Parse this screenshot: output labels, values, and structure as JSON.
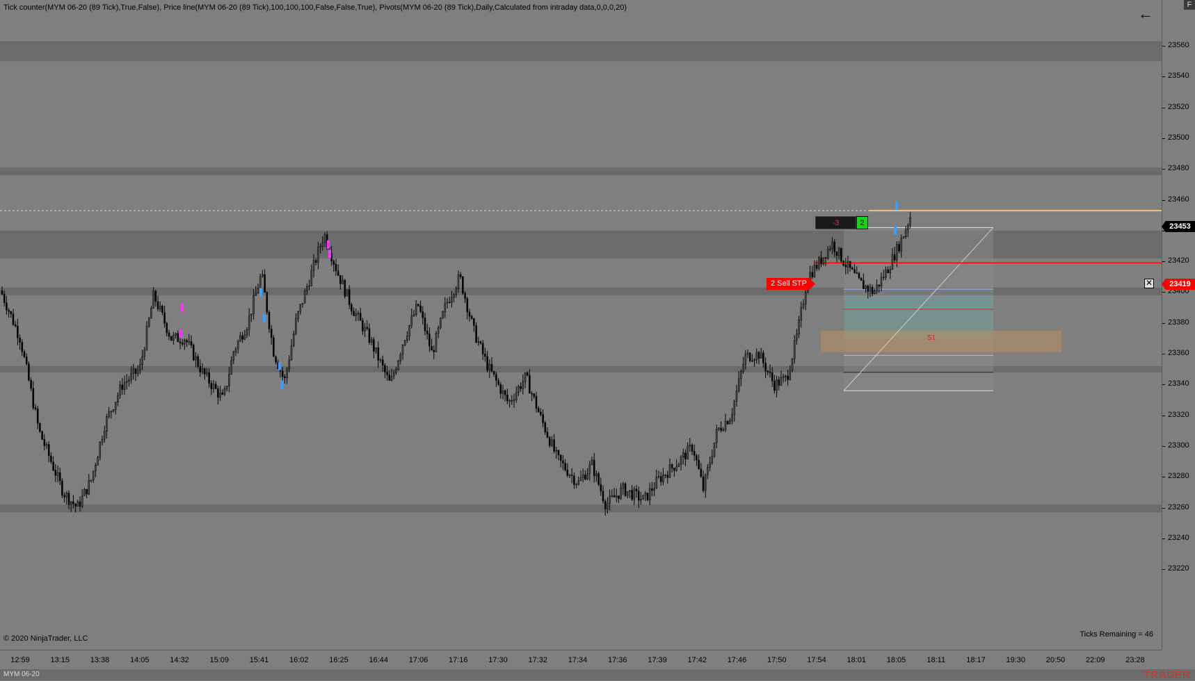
{
  "indicator_header": "Tick counter(MYM 06-20 (89 Tick),True,False), Price line(MYM 06-20 (89 Tick),100,100,100,False,False,True), Pivots(MYM 06-20 (89 Tick),Daily,Calculated from intraday data,0,0,0,20)",
  "copyright": "© 2020 NinjaTrader, LLC",
  "ticks_remaining": "Ticks Remaining = 46",
  "back_icon": "←",
  "f_button": "F",
  "instrument": "MYM 06-20",
  "brand": "TRADER",
  "position": {
    "quantity": "-3",
    "count": "2"
  },
  "order": {
    "label": "2  Sell STP",
    "price": "23419",
    "close_icon": "✕"
  },
  "last_price": "23453",
  "pivot_label": "S1",
  "price_axis": {
    "ticks": [
      "23560",
      "23540",
      "23520",
      "23500",
      "23480",
      "23460",
      "23440",
      "23420",
      "23400",
      "23380",
      "23360",
      "23340",
      "23320",
      "23300",
      "23280",
      "23260",
      "23240",
      "23220"
    ],
    "min": 23210,
    "max": 23580
  },
  "time_axis": {
    "labels": [
      "12:59",
      "13:15",
      "13:38",
      "14:05",
      "14:32",
      "15:09",
      "15:41",
      "16:02",
      "16:25",
      "16:44",
      "17:06",
      "17:16",
      "17:30",
      "17:32",
      "17:34",
      "17:36",
      "17:39",
      "17:42",
      "17:46",
      "17:50",
      "17:54",
      "18:01",
      "18:05",
      "18:11",
      "18:17",
      "19:30",
      "20:50",
      "22:09",
      "23:28"
    ]
  },
  "colors": {
    "background": "#7f7f7f",
    "zone_band": "#6b6b6b",
    "candle": "#000000",
    "last_price_line": "#f5c08a",
    "stop_line": "#ff0000",
    "buy_marker": "#3aa0ff",
    "sell_marker": "#ff33ff"
  },
  "chart_data": {
    "type": "candlestick",
    "series_anchors": [
      [
        0,
        23401
      ],
      [
        28,
        23370
      ],
      [
        55,
        23310
      ],
      [
        90,
        23270
      ],
      [
        110,
        23260
      ],
      [
        130,
        23278
      ],
      [
        150,
        23315
      ],
      [
        175,
        23340
      ],
      [
        200,
        23350
      ],
      [
        220,
        23398
      ],
      [
        245,
        23370
      ],
      [
        265,
        23370
      ],
      [
        290,
        23348
      ],
      [
        320,
        23330
      ],
      [
        335,
        23362
      ],
      [
        355,
        23380
      ],
      [
        375,
        23412
      ],
      [
        392,
        23362
      ],
      [
        408,
        23342
      ],
      [
        425,
        23382
      ],
      [
        445,
        23410
      ],
      [
        465,
        23438
      ],
      [
        485,
        23412
      ],
      [
        505,
        23390
      ],
      [
        530,
        23370
      ],
      [
        560,
        23340
      ],
      [
        580,
        23370
      ],
      [
        600,
        23392
      ],
      [
        620,
        23360
      ],
      [
        640,
        23392
      ],
      [
        660,
        23410
      ],
      [
        680,
        23375
      ],
      [
        700,
        23352
      ],
      [
        730,
        23328
      ],
      [
        755,
        23345
      ],
      [
        775,
        23320
      ],
      [
        800,
        23292
      ],
      [
        830,
        23276
      ],
      [
        850,
        23288
      ],
      [
        870,
        23262
      ],
      [
        895,
        23272
      ],
      [
        925,
        23265
      ],
      [
        945,
        23278
      ],
      [
        975,
        23290
      ],
      [
        995,
        23300
      ],
      [
        1010,
        23272
      ],
      [
        1030,
        23310
      ],
      [
        1050,
        23320
      ],
      [
        1070,
        23358
      ],
      [
        1090,
        23360
      ],
      [
        1112,
        23340
      ],
      [
        1130,
        23344
      ],
      [
        1145,
        23372
      ],
      [
        1160,
        23410
      ],
      [
        1178,
        23420
      ],
      [
        1195,
        23432
      ],
      [
        1215,
        23418
      ],
      [
        1235,
        23406
      ],
      [
        1255,
        23400
      ],
      [
        1275,
        23415
      ],
      [
        1295,
        23434
      ],
      [
        1310,
        23452
      ]
    ],
    "zone_bands": [
      [
        23550,
        23563
      ],
      [
        23476,
        23481
      ],
      [
        23422,
        23440
      ],
      [
        23398,
        23403
      ],
      [
        23348,
        23352
      ],
      [
        23257,
        23262
      ]
    ],
    "buy_markers": [
      [
        375,
        23400
      ],
      [
        380,
        23383
      ],
      [
        402,
        23352
      ],
      [
        405,
        23340
      ],
      [
        1287,
        23440
      ],
      [
        1289,
        23456
      ]
    ],
    "sell_markers": [
      [
        262,
        23390
      ],
      [
        260,
        23373
      ],
      [
        472,
        23431
      ],
      [
        474,
        23425
      ]
    ],
    "last_price": 23453,
    "stop_price": 23419
  }
}
